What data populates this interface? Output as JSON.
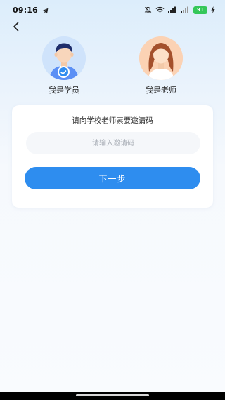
{
  "status_bar": {
    "time": "09:16",
    "battery": "91",
    "icons": [
      "telegram-icon",
      "mute-icon",
      "wifi-icon",
      "signal-icon",
      "signal-icon",
      "battery-icon",
      "charging-icon"
    ]
  },
  "roles": {
    "student": {
      "label": "我是学员",
      "selected": true
    },
    "teacher": {
      "label": "我是老师",
      "selected": false
    }
  },
  "form": {
    "title": "请向学校老师索要邀请码",
    "code_placeholder": "请输入邀请码",
    "code_value": "",
    "next_label": "下一步"
  },
  "colors": {
    "accent": "#2e8def",
    "student_avatar_bg": "#cfe3fb",
    "teacher_avatar_bg": "#fbd2b4"
  }
}
